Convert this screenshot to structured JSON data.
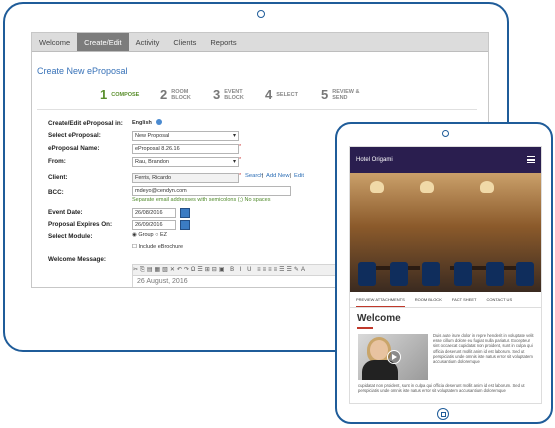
{
  "desktop": {
    "nav_tabs": [
      "Welcome",
      "Create/Edit",
      "Activity",
      "Clients",
      "Reports"
    ],
    "page_title": "Create New eProposal",
    "steps": [
      {
        "num": "1",
        "label": "COMPOSE"
      },
      {
        "num": "2",
        "label": "ROOM\nBLOCK"
      },
      {
        "num": "3",
        "label": "EVENT\nBLOCK"
      },
      {
        "num": "4",
        "label": "SELECT"
      },
      {
        "num": "5",
        "label": "REVIEW &\nSEND"
      }
    ],
    "form": {
      "lang_label": "Create/Edit eProposal in:",
      "lang_value": "English",
      "select_label": "Select eProposal:",
      "select_value": "New Proposal",
      "name_label": "eProposal Name:",
      "name_value": "eProposal 8.26.16",
      "from_label": "From:",
      "from_value": "Rau, Brandon",
      "client_label": "Client:",
      "client_value": "Ferris, Ricardo",
      "client_links": [
        "Search",
        "Add New",
        "Edit"
      ],
      "bcc_label": "BCC:",
      "bcc_value": "mdeyo@cendyn.com",
      "bcc_note": "Separate email addresses with semicolons (;) No spaces",
      "event_date_label": "Event Date:",
      "event_date_value": "26/08/2016",
      "expires_label": "Proposal Expires On:",
      "expires_value": "26/09/2016",
      "module_label": "Select Module:",
      "module_options": [
        "Group",
        "EZ"
      ],
      "ebrochure_label": "Include eBrochure",
      "welcome_label": "Welcome Message:",
      "editor_text": "26 August, 2016"
    }
  },
  "mobile": {
    "logo": "Hotel Origami",
    "tabs": [
      "PREVIEW ATTACHMENTS",
      "ROOM BLOCK",
      "FACT SHEET",
      "CONTACT US"
    ],
    "heading": "Welcome",
    "text_right": "Duis aute irure dolor in repre henderit in voluptate velit esse cillum dolore eu fugiat nulla pariatur. Excepteur sint occaecat cupidatat non proident, sunt in culpa qui officia deserunt mollit anim id est laborum. Sed ut perspiciatis unde omnis iste natus error sit voluptatem accusantium doloremque",
    "text_bottom": "cupidatat non proident, sunt in culpa qui officia deserunt mollit anim id est laborum. Sed ut perspiciatis unde omnis iste natus error sit voluptatem accusantium doloremque"
  }
}
